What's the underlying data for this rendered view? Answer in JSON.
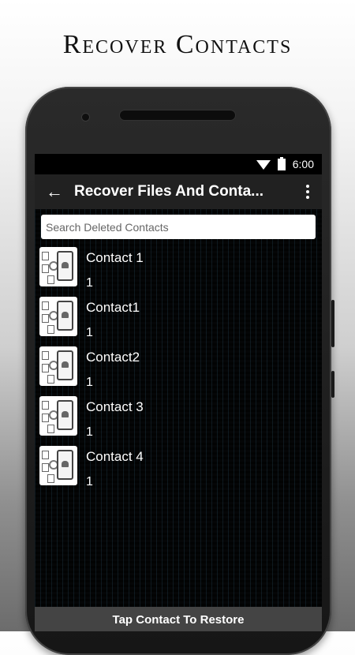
{
  "promo": {
    "title": "Recover Contacts"
  },
  "status_bar": {
    "time": "6:00"
  },
  "app_bar": {
    "title": "Recover Files And Conta..."
  },
  "search": {
    "placeholder": "Search Deleted Contacts"
  },
  "contacts": [
    {
      "name": "Contact 1",
      "count": "1"
    },
    {
      "name": "Contact1",
      "count": "1"
    },
    {
      "name": "Contact2",
      "count": "1"
    },
    {
      "name": "Contact 3",
      "count": "1"
    },
    {
      "name": "Contact 4",
      "count": "1"
    }
  ],
  "footer": {
    "label": "Tap Contact To Restore"
  }
}
